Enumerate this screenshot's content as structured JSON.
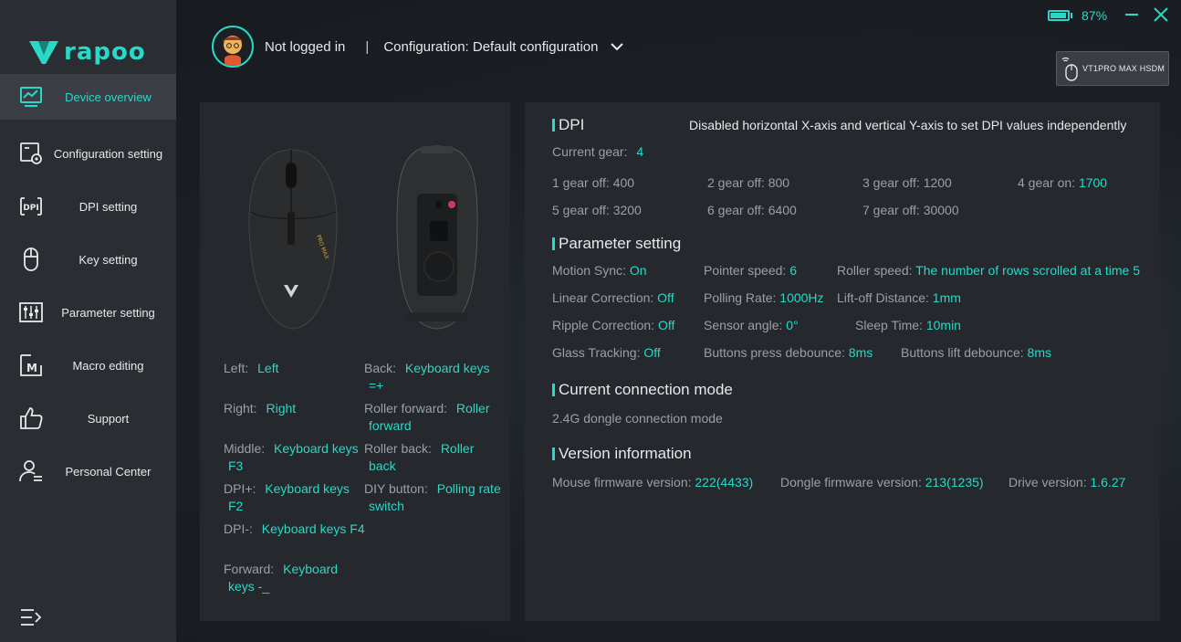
{
  "brand": {
    "logo_text": "rapoo"
  },
  "colors": {
    "accent": "#29d9c8",
    "sidebar_bg": "#2a2d32",
    "panel_bg": "#25282d"
  },
  "sidebar": {
    "items": [
      {
        "label": "Device overview",
        "icon": "chart-monitor-icon",
        "active": true
      },
      {
        "label": "Configuration setting",
        "icon": "config-gear-icon"
      },
      {
        "label": "DPI setting",
        "icon": "dpi-icon"
      },
      {
        "label": "Key setting",
        "icon": "mouse-icon"
      },
      {
        "label": "Parameter setting",
        "icon": "sliders-icon"
      },
      {
        "label": "Macro editing",
        "icon": "macro-icon"
      },
      {
        "label": "Support",
        "icon": "thumbs-up-icon"
      },
      {
        "label": "Personal Center",
        "icon": "user-icon"
      }
    ]
  },
  "header": {
    "login_status": "Not logged in",
    "separator": "|",
    "configuration": "Configuration: Default configuration"
  },
  "battery": {
    "percent_label": "87%",
    "level": 0.87
  },
  "device": {
    "name": "VT1PRO MAX HSDM"
  },
  "keys": {
    "left": {
      "label": "Left:",
      "value": "Left"
    },
    "back": {
      "label": "Back:",
      "value_line1": "Keyboard keys",
      "value_line2": "=+"
    },
    "right": {
      "label": "Right:",
      "value": "Right"
    },
    "roller_forward": {
      "label": "Roller forward:",
      "value_line1": "Roller",
      "value_line2": "forward"
    },
    "middle": {
      "label": "Middle:",
      "value_line1": "Keyboard keys",
      "value_line2": "F3"
    },
    "roller_back": {
      "label": "Roller back:",
      "value_line1": "Roller",
      "value_line2": "back"
    },
    "dpi_plus": {
      "label": "DPI+:",
      "value_line1": "Keyboard keys",
      "value_line2": "F2"
    },
    "diy_button": {
      "label": "DIY button:",
      "value_line1": "Polling rate",
      "value_line2": "switch"
    },
    "dpi_minus": {
      "label": "DPI-:",
      "value": "Keyboard keys F4"
    },
    "forward": {
      "label": "Forward:",
      "value_line1": "Keyboard",
      "value_line2": "keys -_"
    }
  },
  "dpi": {
    "title": "DPI",
    "note": "Disabled horizontal X-axis and vertical Y-axis to set DPI values independently",
    "current_label": "Current gear:",
    "current_value": "4",
    "gears": [
      {
        "label": "1 gear off:",
        "value": "400",
        "on": false
      },
      {
        "label": "2 gear off:",
        "value": "800",
        "on": false
      },
      {
        "label": "3 gear off:",
        "value": "1200",
        "on": false
      },
      {
        "label": "4 gear on:",
        "value": "1700",
        "on": true
      },
      {
        "label": "5 gear off:",
        "value": "3200",
        "on": false
      },
      {
        "label": "6 gear off:",
        "value": "6400",
        "on": false
      },
      {
        "label": "7 gear off:",
        "value": "30000",
        "on": false
      }
    ]
  },
  "parameters": {
    "title": "Parameter setting",
    "items": [
      {
        "label": "Motion Sync:",
        "value": "On"
      },
      {
        "label": "Pointer speed:",
        "value": "6"
      },
      {
        "label": "Roller speed:",
        "value": "The number of rows scrolled at a time 5"
      },
      {
        "label": "Linear Correction:",
        "value": "Off"
      },
      {
        "label": "Polling Rate:",
        "value": "1000Hz"
      },
      {
        "label": "Lift-off Distance:",
        "value": "1mm"
      },
      {
        "label": "Ripple Correction:",
        "value": "Off"
      },
      {
        "label": "Sensor angle:",
        "value": "0°"
      },
      {
        "label": "Sleep Time:",
        "value": "10min"
      },
      {
        "label": "Glass Tracking:",
        "value": "Off"
      },
      {
        "label": "Buttons press debounce:",
        "value": "8ms"
      },
      {
        "label": "Buttons lift debounce:",
        "value": "8ms"
      }
    ]
  },
  "connection": {
    "title": "Current connection mode",
    "mode": "2.4G dongle connection mode"
  },
  "version": {
    "title": "Version information",
    "mouse_label": "Mouse firmware version:",
    "mouse_value": "222(4433)",
    "dongle_label": "Dongle firmware version:",
    "dongle_value": "213(1235)",
    "drive_label": "Drive version:",
    "drive_value": "1.6.27"
  }
}
